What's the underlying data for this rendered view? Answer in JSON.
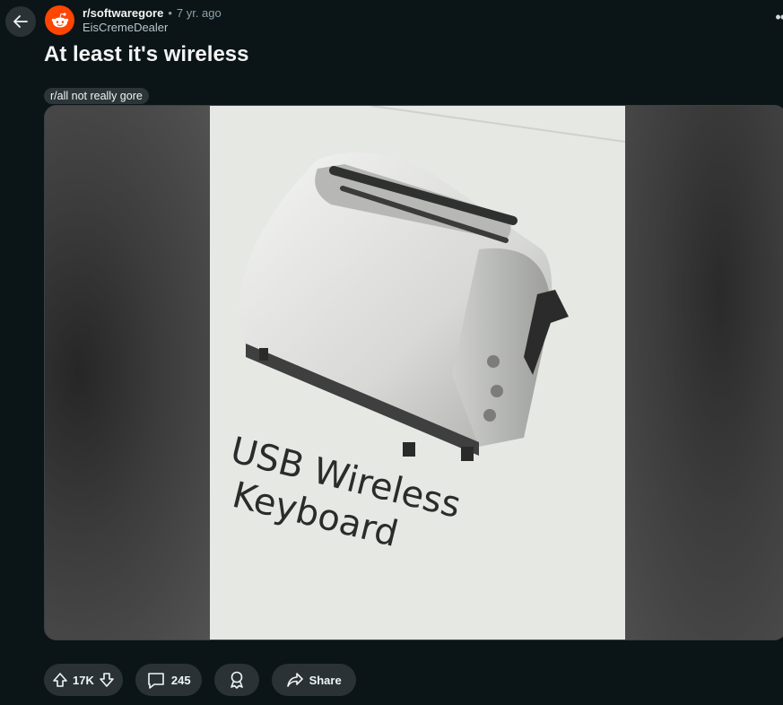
{
  "post": {
    "subreddit": "r/softwaregore",
    "separator": "•",
    "age": "7 yr. ago",
    "author": "EisCremeDealer",
    "title": "At least it's wireless",
    "flair": "r/all not really gore",
    "image_caption_line1": "USB Wireless",
    "image_caption_line2": "Keyboard"
  },
  "actions": {
    "upvotes": "17K",
    "comments": "245",
    "share": "Share"
  },
  "colors": {
    "background": "#0b1416",
    "avatar": "#ff4500",
    "pill": "#2a3236"
  },
  "icons": [
    "back-arrow-icon",
    "reddit-snoo-icon",
    "overflow-dots-icon",
    "upvote-icon",
    "downvote-icon",
    "comment-icon",
    "award-icon",
    "share-icon"
  ]
}
